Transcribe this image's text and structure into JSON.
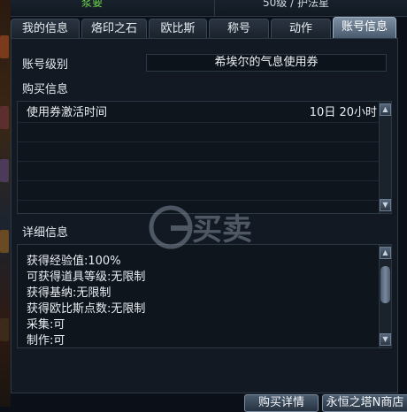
{
  "top_bar": {
    "left_value": "浆要",
    "right_value": "50级 / 护法星"
  },
  "tabs": [
    {
      "label": "我的信息",
      "active": false
    },
    {
      "label": "烙印之石",
      "active": false
    },
    {
      "label": "欧比斯",
      "active": false
    },
    {
      "label": "称号",
      "active": false
    },
    {
      "label": "动作",
      "active": false
    },
    {
      "label": "账号信息",
      "active": true
    }
  ],
  "account": {
    "level_label": "账号级别",
    "level_value": "希埃尔的气息使用券"
  },
  "purchase": {
    "section_label": "购买信息",
    "rows": [
      {
        "name": "使用券激活时间",
        "value": "10日 20小时"
      }
    ]
  },
  "details": {
    "section_label": "详细信息",
    "lines": [
      "获得经验值:100%",
      "可获得道具等级:无限制",
      "获得基纳:无限制",
      "获得欧比斯点数:无限制",
      "采集:可",
      "制作:可"
    ]
  },
  "buttons": {
    "purchase_details": "购买详情",
    "store": "永恒之塔N商店"
  },
  "watermark_text": "G买卖",
  "colors": {
    "accent_green": "#6fd24a",
    "active_tab": "#7d8fa3",
    "panel_bg": "#121922"
  }
}
